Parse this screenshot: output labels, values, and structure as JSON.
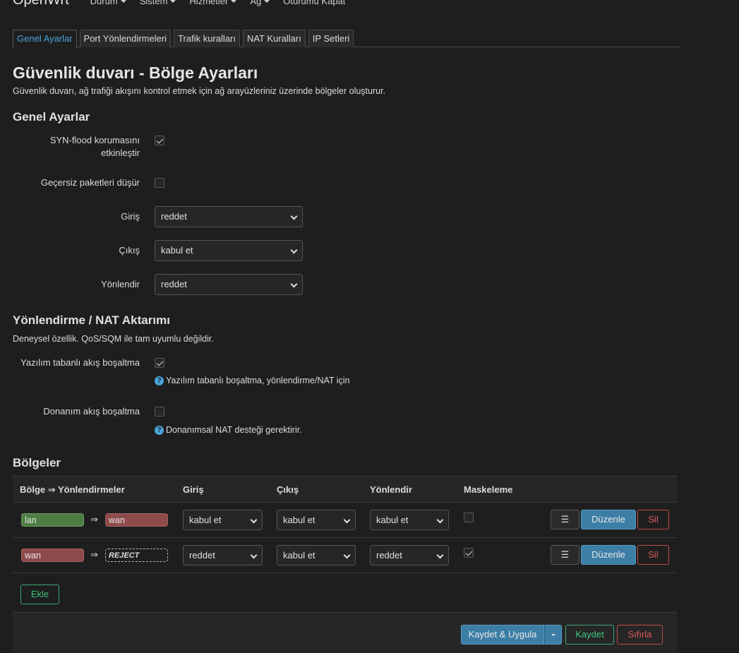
{
  "nav": {
    "brand": "OpenWrt",
    "menu": [
      "Durum",
      "Sistem",
      "Hizmetler",
      "Ağ",
      "Oturumu Kapat"
    ]
  },
  "tabs": [
    "Genel Ayarlar",
    "Port Yönlendirmeleri",
    "Trafik kuralları",
    "NAT Kuralları",
    "IP Setleri"
  ],
  "page": {
    "title": "Güvenlik duvarı - Bölge Ayarları",
    "description": "Güvenlik duvarı, ağ trafiği akışını kontrol etmek için ağ arayüzleriniz üzerinde bölgeler oluşturur."
  },
  "general": {
    "heading": "Genel Ayarlar",
    "syn_flood_label_1": "SYN-flood korumasını",
    "syn_flood_label_2": "etkinleştir",
    "syn_flood_checked": true,
    "drop_invalid_label": "Geçersiz paketleri düşür",
    "drop_invalid_checked": false,
    "input_label": "Giriş",
    "input_value": "reddet",
    "output_label": "Çıkış",
    "output_value": "kabul et",
    "forward_label": "Yönlendir",
    "forward_value": "reddet"
  },
  "offload": {
    "heading": "Yönlendirme / NAT Aktarımı",
    "description": "Deneysel özellik. QoS/SQM ile tam uyumlu değildir.",
    "software_label": "Yazılım tabanlı akış boşaltma",
    "software_checked": true,
    "software_help": "Yazılım tabanlı boşaltma, yönlendirme/NAT için",
    "hardware_label": "Donanım akış boşaltma",
    "hardware_checked": false,
    "hardware_help": "Donanımsal NAT desteği gerektirir."
  },
  "zones": {
    "heading": "Bölgeler",
    "headers": {
      "zone": "Bölge ⇒ Yönlendirmeler",
      "input": "Giriş",
      "output": "Çıkış",
      "forward": "Yönlendir",
      "masq": "Maskeleme"
    },
    "rows": [
      {
        "name": "lan",
        "arrow": "⇒",
        "dest": "wan",
        "input": "kabul et",
        "output": "kabul et",
        "forward": "kabul et",
        "masq": false
      },
      {
        "name": "wan",
        "arrow": "⇒",
        "dest": "REJECT",
        "input": "reddet",
        "output": "kabul et",
        "forward": "reddet",
        "masq": true
      }
    ],
    "menu_icon": "☰",
    "edit_label": "Düzenle",
    "delete_label": "Sil",
    "add_label": "Ekle"
  },
  "footer": {
    "apply_label": "Kaydet & Uygula",
    "save_label": "Kaydet",
    "reset_label": "Sıfırla"
  },
  "colors": {
    "accent": "#4aa3d8",
    "lan": "#4e7d43",
    "wan": "#8d4b4b",
    "danger": "#e05a5a",
    "success": "#3ec47e"
  }
}
